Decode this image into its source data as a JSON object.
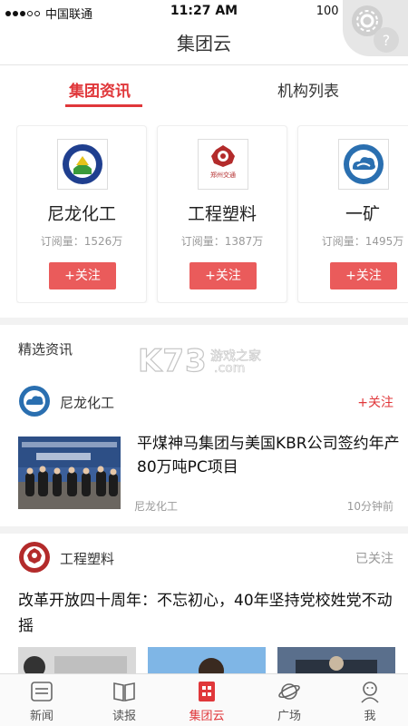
{
  "status_bar": {
    "carrier": "中国联通",
    "time": "11:27 AM",
    "battery": "100 %"
  },
  "header": {
    "title": "集团云"
  },
  "tabs": [
    {
      "label": "集团资讯",
      "active": true
    },
    {
      "label": "机构列表",
      "active": false
    }
  ],
  "org_cards": [
    {
      "name": "尼龙化工",
      "subscribers": "订阅量：1526万",
      "follow_label": "+关注",
      "logo": "cloud-emblem-icon"
    },
    {
      "name": "工程塑料",
      "subscribers": "订阅量：1387万",
      "follow_label": "+关注",
      "logo": "transport-emblem-icon",
      "logo_text": "郑州交通"
    },
    {
      "name": "一矿",
      "subscribers": "订阅量：1495万",
      "follow_label": "+关注",
      "logo": "cloud-emblem-icon"
    }
  ],
  "featured": {
    "section_title": "精选资讯"
  },
  "watermark": {
    "brand": "K73",
    "site_cn": "游戏之家",
    "site_domain": ".com"
  },
  "feed": [
    {
      "source": "尼龙化工",
      "action": "+关注",
      "title": "平煤神马集团与美国KBR公司签约年产80万吨PC项目",
      "meta_source": "尼龙化工",
      "meta_time": "10分钟前"
    },
    {
      "source": "工程塑料",
      "action": "已关注",
      "title": "改革开放四十周年：不忘初心，40年坚持党校姓党不动摇"
    }
  ],
  "bottom_nav": [
    {
      "label": "新闻",
      "icon": "news-icon",
      "active": false
    },
    {
      "label": "读报",
      "icon": "newspaper-icon",
      "active": false
    },
    {
      "label": "集团云",
      "icon": "group-cloud-icon",
      "active": true
    },
    {
      "label": "广场",
      "icon": "planet-icon",
      "active": false
    },
    {
      "label": "我",
      "icon": "user-icon",
      "active": false
    }
  ],
  "colors": {
    "accent": "#e0373a",
    "follow_button": "#ea5b5b",
    "muted": "#999999"
  }
}
